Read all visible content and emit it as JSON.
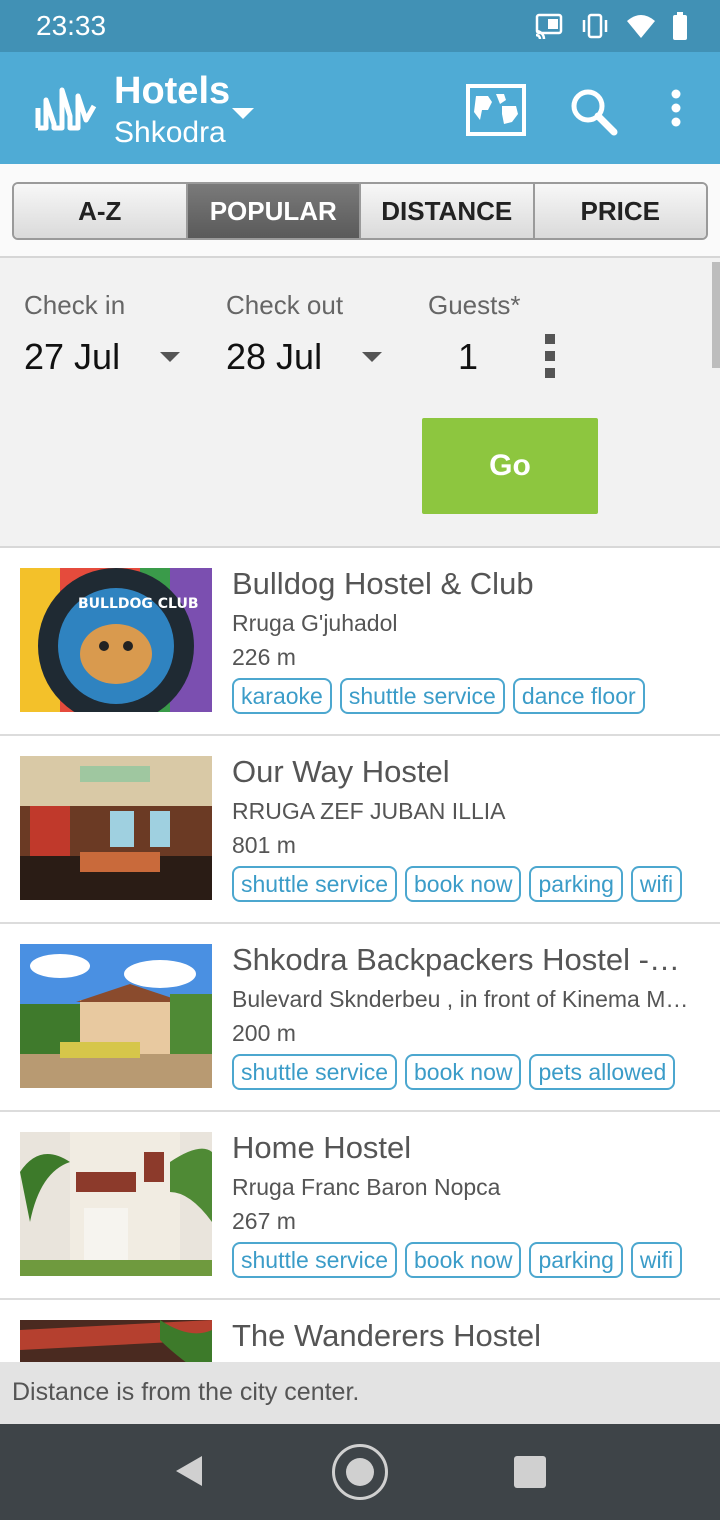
{
  "status_bar": {
    "time": "23:33"
  },
  "app_bar": {
    "title": "Hotels",
    "subtitle": "Shkodra"
  },
  "sort_tabs": [
    {
      "label": "A-Z",
      "active": false
    },
    {
      "label": "POPULAR",
      "active": true
    },
    {
      "label": "DISTANCE",
      "active": false
    },
    {
      "label": "PRICE",
      "active": false
    }
  ],
  "booking": {
    "check_in_label": "Check in",
    "check_in_value": "27 Jul",
    "check_out_label": "Check out",
    "check_out_value": "28 Jul",
    "guests_label": "Guests*",
    "guests_value": "1",
    "go_label": "Go"
  },
  "hotels": [
    {
      "name": "Bulldog Hostel & Club",
      "address": "Rruga G'juhadol",
      "distance": "226 m",
      "tags": [
        "karaoke",
        "shuttle service",
        "dance floor"
      ]
    },
    {
      "name": "Our Way Hostel",
      "address": "RRUGA ZEF JUBAN ILLIA",
      "distance": "801 m",
      "tags": [
        "shuttle service",
        "book now",
        "parking",
        "wifi"
      ]
    },
    {
      "name": "Shkodra Backpackers Hostel -…",
      "address": "Bulevard Sknderbeu , in front of Kinema M…",
      "distance": "200 m",
      "tags": [
        "shuttle service",
        "book now",
        "pets allowed"
      ]
    },
    {
      "name": "Home Hostel",
      "address": "Rruga Franc Baron Nopca",
      "distance": "267 m",
      "tags": [
        "shuttle service",
        "book now",
        "parking",
        "wifi"
      ]
    },
    {
      "name": "The Wanderers Hostel",
      "address": "",
      "distance": "",
      "tags": []
    }
  ],
  "footer_note": "Distance is from the city center.",
  "colors": {
    "status_bar": "#4191b5",
    "app_bar": "#4fabd5",
    "go_button": "#8dc63f",
    "tag_accent": "#4ca7cf"
  }
}
